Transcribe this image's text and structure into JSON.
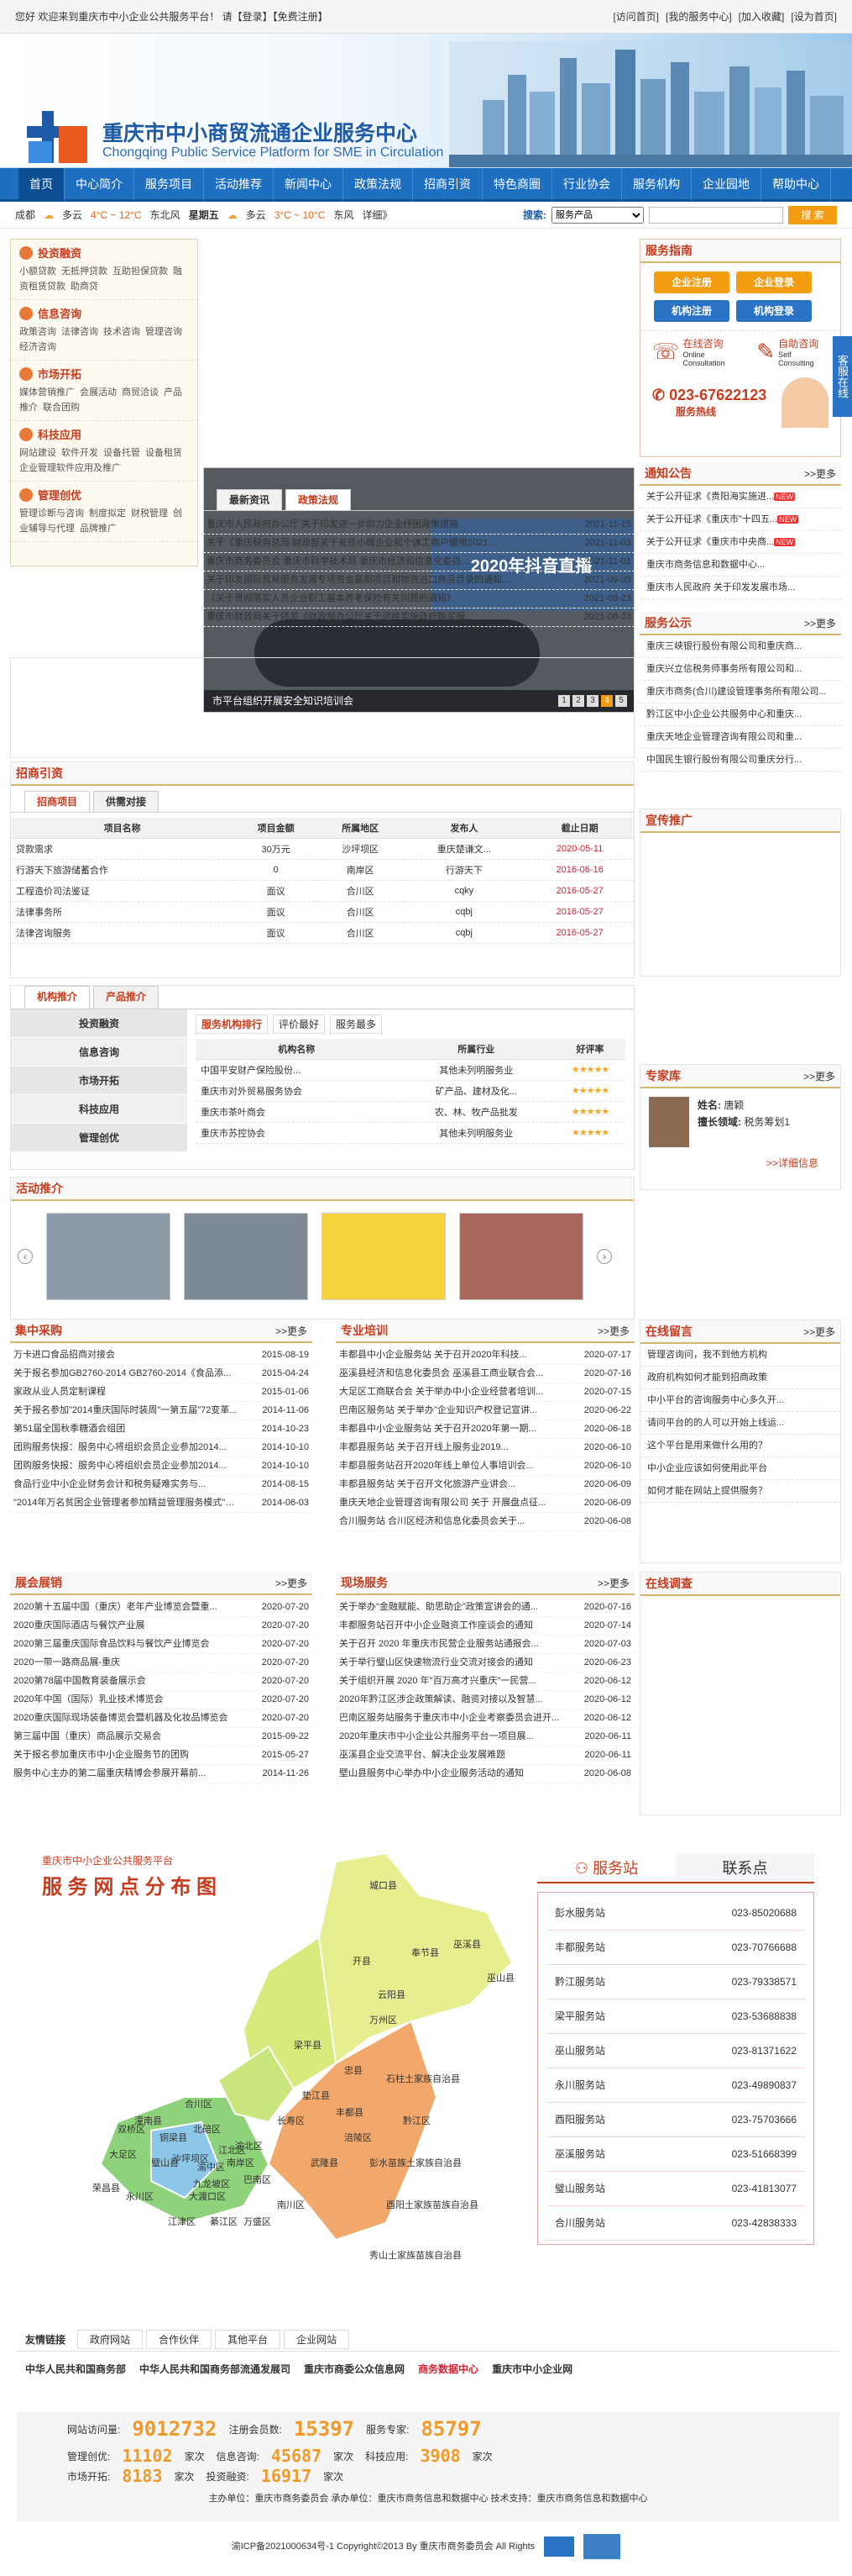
{
  "topbar": {
    "welcome": "您好 欢迎来到重庆市中小企业公共服务平台！ 请【登录】【免费注册】",
    "links": [
      "[访问首页]",
      "[我的服务中心]",
      "[加入收藏]",
      "[设为首页]"
    ]
  },
  "header": {
    "title_cn": "重庆市中小商贸流通企业服务中心",
    "title_en": "Chongqing Public Service Platform for SME in Circulation"
  },
  "nav": [
    "首页",
    "中心简介",
    "服务项目",
    "活动推荐",
    "新闻中心",
    "政策法规",
    "招商引资",
    "特色商圈",
    "行业协会",
    "服务机构",
    "企业园地",
    "帮助中心"
  ],
  "weather": {
    "city1": "成都",
    "w1": "多云",
    "t1": "4°C ~ 12°C",
    "wind1": "东北风",
    "day1": "星期五",
    "w2": "多云",
    "t2": "3°C ~ 10°C",
    "wind2": "东风",
    "more": "详细》",
    "search_label": "搜索:",
    "search_select": "服务产品",
    "search_button": "搜 索"
  },
  "side_cats": [
    {
      "title": "投资融资",
      "links": [
        "小额贷款",
        "无抵押贷款",
        "互助担保贷款",
        "融资租赁贷款",
        "助商贷"
      ]
    },
    {
      "title": "信息咨询",
      "links": [
        "政策咨询",
        "法律咨询",
        "技术咨询",
        "管理咨询",
        "经济咨询"
      ]
    },
    {
      "title": "市场开拓",
      "links": [
        "媒体营销推广",
        "会展活动",
        "商贸洽谈",
        "产品推介",
        "联合团购"
      ]
    },
    {
      "title": "科技应用",
      "links": [
        "网站建设",
        "软件开发",
        "设备托管",
        "设备租赁",
        "企业管理软件应用及推广"
      ]
    },
    {
      "title": "管理创优",
      "links": [
        "管理诊断与咨询",
        "制度拟定",
        "财税管理",
        "创业辅导与代理",
        "品牌推广"
      ]
    }
  ],
  "slide": {
    "caption": "市平台组织开展安全知识培训会",
    "pages": [
      "1",
      "2",
      "3",
      "4",
      "5"
    ],
    "banner": "2020年抖音直播"
  },
  "news_tabs": [
    "最新资讯",
    "政策法规"
  ],
  "news": [
    {
      "t": "重庆市人民政府办公厅 关于印发进一步助力企业纾困政策措施...",
      "d": "2021-11-15"
    },
    {
      "t": "关于《重庆税务总局 财政部关于有些小微企业和个体工商户缓缴2021...",
      "d": "2021-11-03"
    },
    {
      "t": "重庆市商务委员会 重庆市科学技术局 重庆市经济和信息化委员...",
      "d": "2021-11-01"
    },
    {
      "t": "关于印发国际贸易服务发展专项资金最期项目和物资进口商品目录的通知...",
      "d": "2021-09-03"
    },
    {
      "t": "《关于贯彻落实人员企业职工基本养老保险有关问题的通知》",
      "d": "2021-08-23"
    },
    {
      "t": "重庆市财政局关于转发《财政部办公厅关于继续实施政府购买服...",
      "d": "2021-08-23"
    }
  ],
  "guide": {
    "title": "服务指南",
    "btns": [
      "企业注册",
      "企业登录",
      "机构注册",
      "机构登录"
    ],
    "online": "在线咨询",
    "online_en": "Online Consultation",
    "self": "自助咨询",
    "self_en": "Self Consulting",
    "hotline_label": "服务热线",
    "hotline": "023-67622123"
  },
  "side_float": "客服在线",
  "notice": {
    "title": "通知公告",
    "more": ">>更多",
    "items": [
      "关于公开征求《贵阳海实施进...",
      "关于公开征求《重庆市\"十四五...",
      "关于公开征求《重庆市中央商...",
      "重庆市商务信息和数据中心...",
      "重庆市人民政府 关于印发发展市场..."
    ]
  },
  "publicity": {
    "title": "服务公示",
    "more": ">>更多",
    "items": [
      "重庆三峡银行股份有限公司和重庆商...",
      "重庆兴立信税务师事务所有限公司和...",
      "重庆市商务(合川)建设管理事务所有限公司...",
      "黔江区中小企业公共服务中心和重庆...",
      "重庆天地企业管理咨询有限公司和重...",
      "中国民生银行股份有限公司重庆分行..."
    ]
  },
  "promo": {
    "title": "宣传推广"
  },
  "investment": {
    "title": "招商引资",
    "tabs": [
      "招商项目",
      "供需对接"
    ],
    "headers": [
      "项目名称",
      "项目金额",
      "所属地区",
      "发布人",
      "截止日期"
    ],
    "rows": [
      [
        "贷款需求",
        "30万元",
        "沙坪坝区",
        "重庆楚谦文...",
        "2020-05-11"
      ],
      [
        "行游天下旅游储蓄合作",
        "0",
        "南岸区",
        "行游天下",
        "2016-06-16"
      ],
      [
        "工程造价司法鉴证",
        "面议",
        "合川区",
        "cqky",
        "2016-05-27"
      ],
      [
        "法律事务所",
        "面议",
        "合川区",
        "cqbj",
        "2016-05-27"
      ],
      [
        "法律咨询服务",
        "面议",
        "合川区",
        "cqbj",
        "2016-05-27"
      ]
    ]
  },
  "org": {
    "tabs": [
      "机构推介",
      "产品推介"
    ],
    "cats": [
      "投资融资",
      "信息咨询",
      "市场开拓",
      "科技应用",
      "管理创优"
    ],
    "subtabs": [
      "服务机构排行",
      "评价最好",
      "服务最多"
    ],
    "headers": [
      "机构名称",
      "所属行业",
      "好评率"
    ],
    "rows": [
      [
        "中国平安财产保险股份...",
        "其他未列明服务业",
        5
      ],
      [
        "重庆市对外贸易服务协会",
        "矿产品、建材及化...",
        5
      ],
      [
        "重庆市茶叶商会",
        "农、林、牧产品批发",
        5
      ],
      [
        "重庆市苏控协会",
        "其他未列明服务业",
        5
      ]
    ]
  },
  "experts": {
    "title": "专家库",
    "more": ">>更多",
    "name_label": "姓名:",
    "name": "唐颖",
    "field_label": "擅长领域:",
    "field": "税务筹划1",
    "detail": ">>详细信息"
  },
  "activity": {
    "title": "活动推介"
  },
  "purchase": {
    "title": "集中采购",
    "more": ">>更多",
    "items": [
      {
        "t": "万卡进口食品招商对接会",
        "d": "2015-08-19"
      },
      {
        "t": "关于报名参加GB2760-2014 GB2760-2014《食品添...",
        "d": "2015-04-24"
      },
      {
        "t": "家政从业人员定制课程",
        "d": "2015-01-06"
      },
      {
        "t": "关于报名参加\"2014重庆国际时装周\"一第五届\"72变革...",
        "d": "2014-11-06"
      },
      {
        "t": "第51届全国秋季糖酒会组团",
        "d": "2014-10-23"
      },
      {
        "t": "团购服务快报：服务中心将组织会员企业参加2014...",
        "d": "2014-10-10"
      },
      {
        "t": "团购服务快报：服务中心将组织会员企业参加2014...",
        "d": "2014-10-10"
      },
      {
        "t": "食品行业中小企业财务会计和税务疑难实务与...",
        "d": "2014-08-15"
      },
      {
        "t": "\"2014年万名贫困企业管理者参加精益管理服务模式\"培训...",
        "d": "2014-06-03"
      }
    ]
  },
  "training": {
    "title": "专业培训",
    "more": ">>更多",
    "items": [
      {
        "t": "丰都县中小企业服务站 关于召开2020年科技...",
        "d": "2020-07-17"
      },
      {
        "t": "巫溪县经济和信息化委员会 巫溪县工商业联合会...",
        "d": "2020-07-16"
      },
      {
        "t": "大足区工商联合会 关于举办中小企业经营者培训...",
        "d": "2020-07-15"
      },
      {
        "t": "巴南区服务站 关于举办\"企业知识产权登记宣讲...",
        "d": "2020-06-22"
      },
      {
        "t": "丰都县中小企业服务站 关于召开2020年第一期...",
        "d": "2020-06-18"
      },
      {
        "t": "丰都县服务站 关于召开线上服务业2019...",
        "d": "2020-06-10"
      },
      {
        "t": "丰都县服务站召开2020年线上单位人事培训会...",
        "d": "2020-06-10"
      },
      {
        "t": "丰都县服务站 关于召开文化旅游产业讲会...",
        "d": "2020-06-09"
      },
      {
        "t": "重庆天地企业管理咨询有限公司 关于 开展盘点征...",
        "d": "2020-06-09"
      },
      {
        "t": "合川服务站 合川区经济和信息化委员会关于...",
        "d": "2020-06-08"
      }
    ]
  },
  "leave_msg": {
    "title": "在线留言",
    "more": ">>更多",
    "items": [
      "管理咨询问，我不到他方机构",
      "政府机构如何才能到招商政策",
      "中小平台的咨询服务中心多久开...",
      "请问平台的的人可以开始上线运...",
      "这个平台是用来做什么用的？",
      "中小企业应该如何使用此平台",
      "如何才能在网站上提供服务？"
    ]
  },
  "exhibition": {
    "title": "展会展销",
    "more": ">>更多",
    "items": [
      {
        "t": "2020第十五届中国（重庆）老年产业博览会暨重...",
        "d": "2020-07-20"
      },
      {
        "t": "2020重庆国际酒店与餐饮产业展",
        "d": "2020-07-20"
      },
      {
        "t": "2020第三届重庆国际食品饮料与餐饮产业博览会",
        "d": "2020-07-20"
      },
      {
        "t": "2020一带一路商品展-重庆",
        "d": "2020-07-20"
      },
      {
        "t": "2020第78届中国教育装备展示会",
        "d": "2020-07-20"
      },
      {
        "t": "2020年中国（国际）乳业技术博览会",
        "d": "2020-07-20"
      },
      {
        "t": "2020重庆国际现场装备博览会暨机器及化妆品博览会",
        "d": "2020-07-20"
      },
      {
        "t": "第三届中国（重庆）商品展示交易会",
        "d": "2015-09-22"
      },
      {
        "t": "关于报名参加重庆市中小企业服务节的团购",
        "d": "2015-05-27"
      },
      {
        "t": "服务中心主办的第二届重庆精博会参展开幕前...",
        "d": "2014-11-26"
      }
    ]
  },
  "onsite": {
    "title": "现场服务",
    "more": ">>更多",
    "items": [
      {
        "t": "关于举办\"金融赋能、助思助企\"政策宣讲会的通...",
        "d": "2020-07-16"
      },
      {
        "t": "丰都服务站召开中小企业融资工作座谈会的通知",
        "d": "2020-07-14"
      },
      {
        "t": "关于召开 2020 年重庆市民营企业服务站通报会...",
        "d": "2020-07-03"
      },
      {
        "t": "关于举行璧山区快速物流行业交流对接会的通知",
        "d": "2020-06-23"
      },
      {
        "t": "关于组织开展 2020 年\"百万高才兴重庆\"一民营...",
        "d": "2020-06-12"
      },
      {
        "t": "2020年黔江区涉企政策解读、融资对接以及智慧...",
        "d": "2020-06-12"
      },
      {
        "t": "巴南区服务站服务于重庆市中小企业考察委员会进开...",
        "d": "2020-06-12"
      },
      {
        "t": "2020年重庆市中小企业公共服务平台一项目展...",
        "d": "2020-06-11"
      },
      {
        "t": "巫溪县企业交流平台、解决企业发展难题",
        "d": "2020-06-11"
      },
      {
        "t": "壁山县服务中心举办中小企业服务活动的通知",
        "d": "2020-06-08"
      }
    ]
  },
  "survey": {
    "title": "在线调查"
  },
  "map": {
    "title_small": "重庆市中小企业公共服务平台",
    "title": "服 务 网 点 分 布 图",
    "tab_station": "服务站",
    "tab_contact": "联系点",
    "stations": [
      [
        "彭水服务站",
        "023-85020688"
      ],
      [
        "丰都服务站",
        "023-70766688"
      ],
      [
        "黔江服务站",
        "023-79338571"
      ],
      [
        "梁平服务站",
        "023-53688838"
      ],
      [
        "巫山服务站",
        "023-81371622"
      ],
      [
        "永川服务站",
        "023-49890837"
      ],
      [
        "酉阳服务站",
        "023-75703666"
      ],
      [
        "巫溪服务站",
        "023-51668399"
      ],
      [
        "璧山服务站",
        "023-41813077"
      ],
      [
        "合川服务站",
        "023-42838333"
      ]
    ],
    "districts": [
      "城口县",
      "巫溪县",
      "巫山县",
      "奉节县",
      "开县",
      "云阳县",
      "万州区",
      "梁平县",
      "忠县",
      "石柱土家族自治县",
      "垫江县",
      "丰都县",
      "长寿区",
      "涪陵区",
      "武隆县",
      "彭水苗族土家族自治县",
      "黔江区",
      "酉阳土家族苗族自治县",
      "秀山土家族苗族自治县",
      "南川区",
      "綦江区",
      "万盛区",
      "巴南区",
      "渝北区",
      "北碚区",
      "江北区",
      "渝中区",
      "南岸区",
      "九龙坡区",
      "沙坪坝区",
      "大渡口区",
      "璧山县",
      "合川区",
      "潼南县",
      "铜梁县",
      "大足区",
      "荣昌县",
      "永川区",
      "江津区",
      "双桥区"
    ]
  },
  "friendlinks": {
    "title": "友情链接",
    "tabs": [
      "政府网站",
      "合作伙伴",
      "其他平台",
      "企业网站"
    ],
    "items": [
      "中华人民共和国商务部",
      "中华人民共和国商务部流通发展司",
      "重庆市商委公众信息网",
      "商务数据中心",
      "重庆市中小企业网"
    ]
  },
  "stats": {
    "visits_label": "网站访问量:",
    "visits": "9012732",
    "members_label": "注册会员数:",
    "members": "15397",
    "experts_label": "服务专家:",
    "experts": "85797",
    "creation_label": "管理创优:",
    "creation": "11102",
    "unit": "家次",
    "consult_label": "信息咨询:",
    "consult": "45687",
    "consult_unit": "家次",
    "tech_label": "科技应用:",
    "tech": "3908",
    "tech_unit": "家次",
    "market_label": "市场开拓:",
    "market": "8183",
    "market_unit": "家次",
    "invest_label": "投资融资:",
    "invest": "16917",
    "invest_unit": "家次",
    "host": "主办单位：重庆市商务委员会   承办单位：重庆市商务信息和数据中心   技术支持：重庆市商务信息和数据中心",
    "copyright": "渝ICP备2021000634号-1 Copyright©2013 By 重庆市商务委员会 All Rights"
  }
}
